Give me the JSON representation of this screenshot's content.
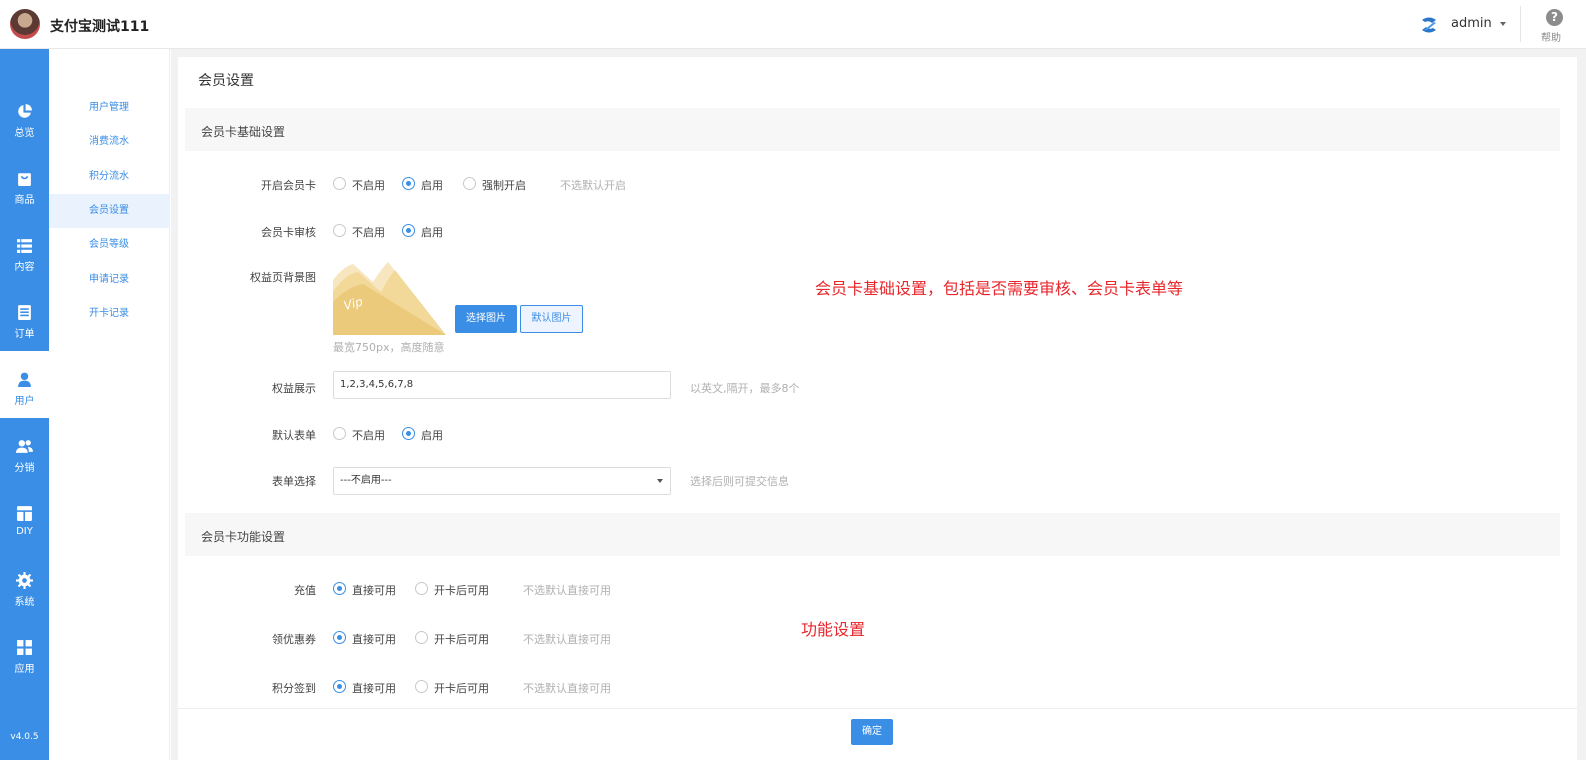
{
  "header": {
    "shop_name": "支付宝测试111",
    "admin_name": "admin",
    "help_label": "帮助",
    "help_glyph": "?"
  },
  "mainnav": {
    "items": [
      {
        "label": "总览",
        "icon": "pie-chart-icon"
      },
      {
        "label": "商品",
        "icon": "shopping-bag-icon"
      },
      {
        "label": "内容",
        "icon": "list-icon"
      },
      {
        "label": "订单",
        "icon": "document-icon"
      },
      {
        "label": "用户",
        "icon": "user-icon",
        "active": true
      },
      {
        "label": "分销",
        "icon": "users-icon"
      },
      {
        "label": "DIY",
        "icon": "layout-icon"
      },
      {
        "label": "系统",
        "icon": "gear-icon"
      },
      {
        "label": "应用",
        "icon": "grid-icon"
      }
    ],
    "version": "v4.0.5"
  },
  "subnav": {
    "items": [
      {
        "label": "用户管理"
      },
      {
        "label": "消费流水"
      },
      {
        "label": "积分流水"
      },
      {
        "label": "会员设置",
        "active": true
      },
      {
        "label": "会员等级"
      },
      {
        "label": "申请记录"
      },
      {
        "label": "开卡记录"
      }
    ]
  },
  "page": {
    "title": "会员设置",
    "section1": {
      "title": "会员卡基础设置",
      "open_card": {
        "label": "开启会员卡",
        "options": [
          "不启用",
          "启用",
          "强制开启"
        ],
        "selected": 1,
        "hint": "不选默认开启"
      },
      "audit": {
        "label": "会员卡审核",
        "options": [
          "不启用",
          "启用"
        ],
        "selected": 1
      },
      "bg_image": {
        "label": "权益页背景图",
        "preview_text": "Vip",
        "choose_button": "选择图片",
        "default_button": "默认图片",
        "hint": "最宽750px，高度随意"
      },
      "benefits": {
        "label": "权益展示",
        "value": "1,2,3,4,5,6,7,8",
        "hint": "以英文,隔开，最多8个"
      },
      "default_form": {
        "label": "默认表单",
        "options": [
          "不启用",
          "启用"
        ],
        "selected": 1
      },
      "form_select": {
        "label": "表单选择",
        "value": "---不启用---",
        "hint": "选择后则可提交信息"
      }
    },
    "annotation1": "会员卡基础设置，包括是否需要审核、会员卡表单等",
    "section2": {
      "title": "会员卡功能设置",
      "rows": [
        {
          "label": "充值",
          "options": [
            "直接可用",
            "开卡后可用"
          ],
          "selected": 0,
          "hint": "不选默认直接可用"
        },
        {
          "label": "领优惠券",
          "options": [
            "直接可用",
            "开卡后可用"
          ],
          "selected": 0,
          "hint": "不选默认直接可用"
        },
        {
          "label": "积分签到",
          "options": [
            "直接可用",
            "开卡后可用"
          ],
          "selected": 0,
          "hint": "不选默认直接可用"
        }
      ]
    },
    "annotation2": "功能设置",
    "confirm_button": "确定"
  },
  "colors": {
    "accent": "#3a8ee6",
    "annotation": "#e8262b"
  }
}
